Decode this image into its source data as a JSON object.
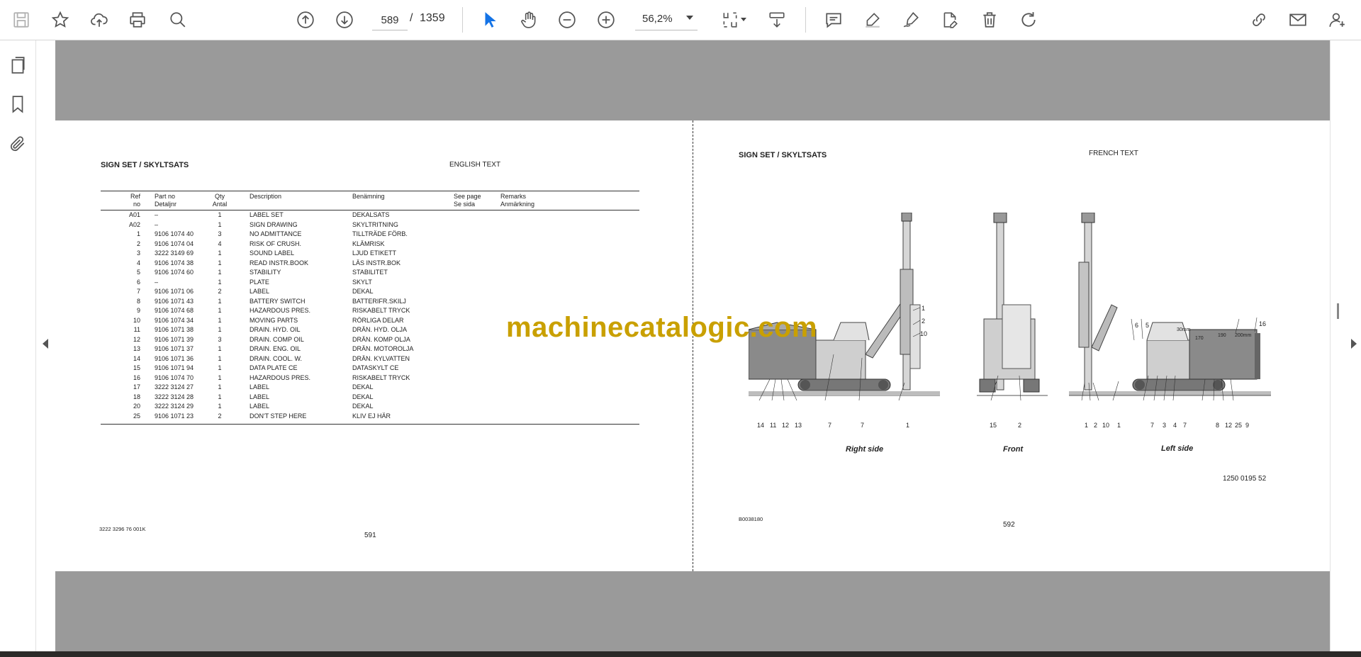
{
  "toolbar": {
    "page_current": "589",
    "page_separator": "/",
    "page_total": "1359",
    "zoom": "56,2%"
  },
  "left_page": {
    "title": "SIGN SET / SKYLTSATS",
    "language": "ENGLISH TEXT",
    "doc_code": "3222 3296 76 001K",
    "page_number": "591",
    "table": {
      "headers": {
        "ref": [
          "Ref",
          "no"
        ],
        "part": [
          "Part no",
          "Detaljnr"
        ],
        "qty": [
          "Qty",
          "Antal"
        ],
        "desc": [
          "Description",
          ""
        ],
        "ben": [
          "Benämning",
          ""
        ],
        "see": [
          "See page",
          "Se sida"
        ],
        "rem": [
          "Remarks",
          "Anmärkning"
        ]
      },
      "rows": [
        {
          "ref": "A01",
          "part": "–",
          "qty": "1",
          "desc": "LABEL SET",
          "ben": "DEKALSATS"
        },
        {
          "ref": "A02",
          "part": "–",
          "qty": "1",
          "desc": "SIGN DRAWING",
          "ben": "SKYLTRITNING"
        },
        {
          "ref": "1",
          "part": "9106 1074 40",
          "qty": "3",
          "desc": "NO ADMITTANCE",
          "ben": "TILLTRÄDE FÖRB."
        },
        {
          "ref": "2",
          "part": "9106 1074 04",
          "qty": "4",
          "desc": "RISK OF CRUSH.",
          "ben": "KLÄMRISK"
        },
        {
          "ref": "3",
          "part": "3222 3149 69",
          "qty": "1",
          "desc": "SOUND LABEL",
          "ben": "LJUD ETIKETT"
        },
        {
          "ref": "4",
          "part": "9106 1074 38",
          "qty": "1",
          "desc": "READ INSTR.BOOK",
          "ben": "LÄS INSTR.BOK"
        },
        {
          "ref": "5",
          "part": "9106 1074 60",
          "qty": "1",
          "desc": "STABILITY",
          "ben": "STABILITET"
        },
        {
          "ref": "6",
          "part": "–",
          "qty": "1",
          "desc": "PLATE",
          "ben": "SKYLT"
        },
        {
          "ref": "7",
          "part": "9106 1071 06",
          "qty": "2",
          "desc": "LABEL",
          "ben": "DEKAL"
        },
        {
          "ref": "8",
          "part": "9106 1071 43",
          "qty": "1",
          "desc": "BATTERY SWITCH",
          "ben": "BATTERIFR.SKILJ"
        },
        {
          "ref": "9",
          "part": "9106 1074 68",
          "qty": "1",
          "desc": "HAZARDOUS PRES.",
          "ben": "RISKABELT TRYCK"
        },
        {
          "ref": "10",
          "part": "9106 1074 34",
          "qty": "1",
          "desc": "MOVING PARTS",
          "ben": "RÖRLIGA DELAR"
        },
        {
          "ref": "11",
          "part": "9106 1071 38",
          "qty": "1",
          "desc": "DRAIN. HYD. OIL",
          "ben": "DRÄN. HYD. OLJA"
        },
        {
          "ref": "12",
          "part": "9106 1071 39",
          "qty": "3",
          "desc": "DRAIN. COMP OIL",
          "ben": "DRÄN. KOMP OLJA"
        },
        {
          "ref": "13",
          "part": "9106 1071 37",
          "qty": "1",
          "desc": "DRAIN. ENG. OIL",
          "ben": "DRÄN. MOTOROLJA"
        },
        {
          "ref": "14",
          "part": "9106 1071 36",
          "qty": "1",
          "desc": "DRAIN. COOL. W.",
          "ben": "DRÄN. KYLVATTEN"
        },
        {
          "ref": "15",
          "part": "9106 1071 94",
          "qty": "1",
          "desc": "DATA PLATE CE",
          "ben": "DATASKYLT CE"
        },
        {
          "ref": "16",
          "part": "9106 1074 70",
          "qty": "1",
          "desc": "HAZARDOUS PRES.",
          "ben": "RISKABELT TRYCK"
        },
        {
          "ref": "17",
          "part": "3222 3124 27",
          "qty": "1",
          "desc": "LABEL",
          "ben": "DEKAL"
        },
        {
          "ref": "18",
          "part": "3222 3124 28",
          "qty": "1",
          "desc": "LABEL",
          "ben": "DEKAL"
        },
        {
          "ref": "20",
          "part": "3222 3124 29",
          "qty": "1",
          "desc": "LABEL",
          "ben": "DEKAL"
        },
        {
          "ref": "25",
          "part": "9106 1071 23",
          "qty": "2",
          "desc": "DON'T STEP HERE",
          "ben": "KLIV EJ HÄR"
        }
      ]
    }
  },
  "right_page": {
    "title": "SIGN SET / SKYLTSATS",
    "language": "FRENCH TEXT",
    "drawing_code": "B0038180",
    "page_number": "592",
    "part_ref": "1250 0195 52",
    "views": {
      "right": {
        "caption": "Right side",
        "callouts": [
          "14",
          "11",
          "12",
          "13",
          "7",
          "7",
          "1",
          "1",
          "2",
          "10"
        ]
      },
      "front": {
        "caption": "Front",
        "callouts": [
          "15",
          "2"
        ]
      },
      "left": {
        "caption": "Left side",
        "callouts": [
          "1",
          "2",
          "10",
          "1",
          "7",
          "3",
          "4",
          "7",
          "8",
          "12",
          "25",
          "9",
          "6",
          "5",
          "30mm",
          "170",
          "190",
          "200mm",
          "16"
        ]
      }
    }
  },
  "watermark": "machinecatalogic.com"
}
